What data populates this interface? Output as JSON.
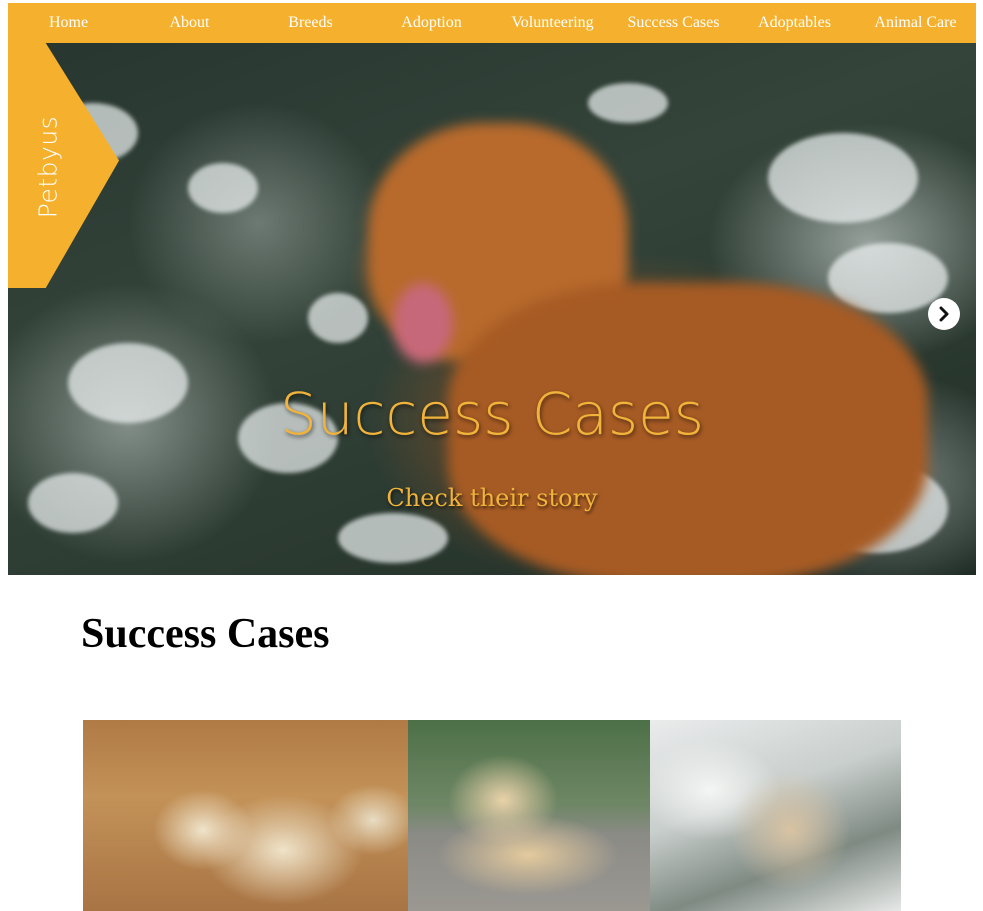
{
  "nav": {
    "items": [
      {
        "label": "Home"
      },
      {
        "label": "About"
      },
      {
        "label": "Breeds"
      },
      {
        "label": "Adoption"
      },
      {
        "label": "Volunteering"
      },
      {
        "label": "Success Cases"
      },
      {
        "label": "Adoptables"
      },
      {
        "label": "Animal Care"
      }
    ]
  },
  "brand": {
    "logo_text": "Petbyus",
    "accent_color": "#f5b12e"
  },
  "hero": {
    "title": "Success Cases",
    "subtitle": "Check their story",
    "next_icon": "chevron-right-icon",
    "image": "golden-retriever-in-snowy-bushes"
  },
  "main": {
    "title": "Success Cases",
    "gallery": [
      {
        "image": "curly-dog-running-in-grass"
      },
      {
        "image": "puppy-lying-on-deck"
      },
      {
        "image": "curly-dog-in-snow"
      }
    ]
  }
}
